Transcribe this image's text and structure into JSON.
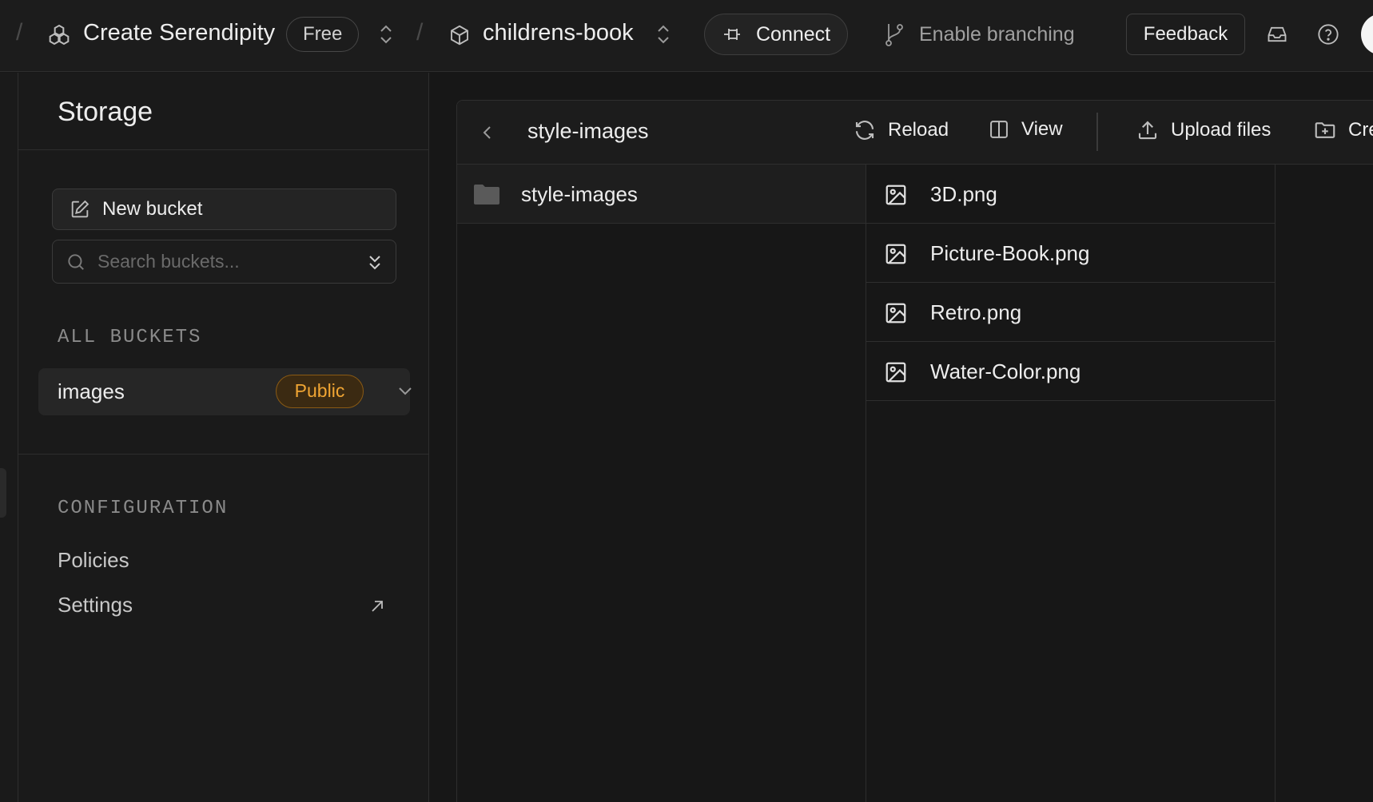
{
  "topbar": {
    "org_name": "Create Serendipity",
    "plan": "Free",
    "project_name": "childrens-book",
    "connect_label": "Connect",
    "branching_label": "Enable branching",
    "feedback_label": "Feedback",
    "icons": [
      "organization-icon",
      "project-box-icon",
      "plug-icon",
      "git-branch-icon",
      "inbox-icon",
      "help-icon"
    ]
  },
  "sidebar": {
    "title": "Storage",
    "new_bucket_label": "New bucket",
    "search_placeholder": "Search buckets...",
    "all_buckets_label": "ALL BUCKETS",
    "buckets": [
      {
        "name": "images",
        "badge": "Public"
      }
    ],
    "configuration_label": "CONFIGURATION",
    "config_links": [
      "Policies",
      "Settings"
    ]
  },
  "explorer": {
    "path": "style-images",
    "tools": {
      "reload": "Reload",
      "view": "View",
      "upload": "Upload files",
      "create": "Cre"
    },
    "folders": [
      "style-images"
    ],
    "files": [
      "3D.png",
      "Picture-Book.png",
      "Retro.png",
      "Water-Color.png"
    ]
  },
  "colors": {
    "background": "#171717",
    "panel": "#1c1c1c",
    "border": "#2e2e2e",
    "public_badge_text": "#f0a533",
    "public_badge_bg": "#3b2a12"
  }
}
